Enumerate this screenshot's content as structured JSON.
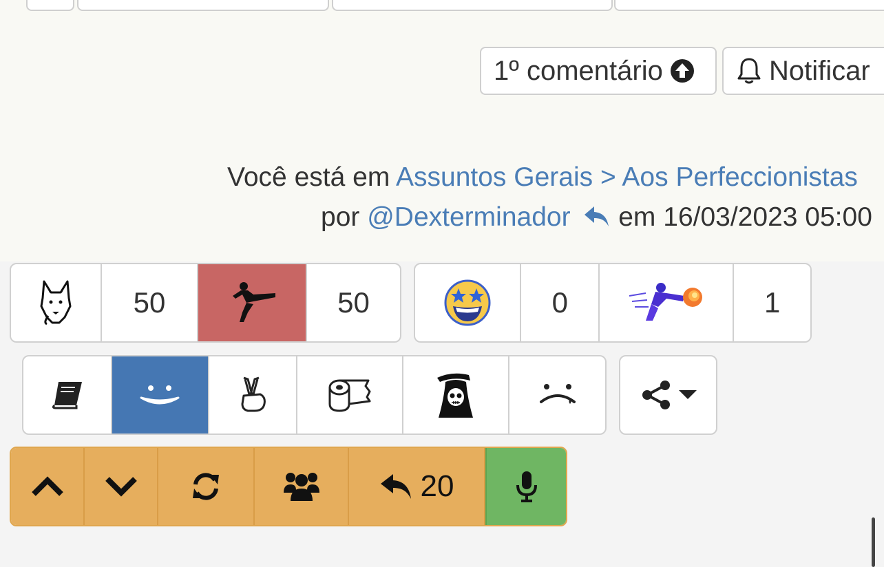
{
  "header": {
    "first_comment_label": "1º comentário",
    "notify_label": "Notificar"
  },
  "breadcrumb": {
    "prefix": "Você está em ",
    "path": "Assuntos Gerais > Aos Perfeccionistas"
  },
  "byline": {
    "prefix": "por ",
    "author": "@Dexterminador",
    "date_prefix": " em ",
    "date": "16/03/2023 05:00"
  },
  "vote_group": {
    "left_icon": "wolf-icon",
    "left_count": "50",
    "right_icon": "kick-icon",
    "right_count": "50"
  },
  "rating_group": {
    "star_eyes_icon": "star-eyes-emoji-icon",
    "star_eyes_count": "0",
    "flying_kick_icon": "flying-kick-icon",
    "flying_kick_count": "1"
  },
  "reactions": [
    "book-icon",
    "smile-icon",
    "peace-hand-icon",
    "toilet-paper-icon",
    "grim-reaper-icon",
    "sad-face-icon"
  ],
  "share": {
    "icon": "share-icon"
  },
  "toolbar": {
    "reply_count": "20"
  },
  "colors": {
    "accent_link": "#4a7db6",
    "active_red": "#c86664",
    "active_blue": "#4577b3",
    "toolbar_orange": "#e6ae5d",
    "toolbar_green": "#6fb663"
  }
}
